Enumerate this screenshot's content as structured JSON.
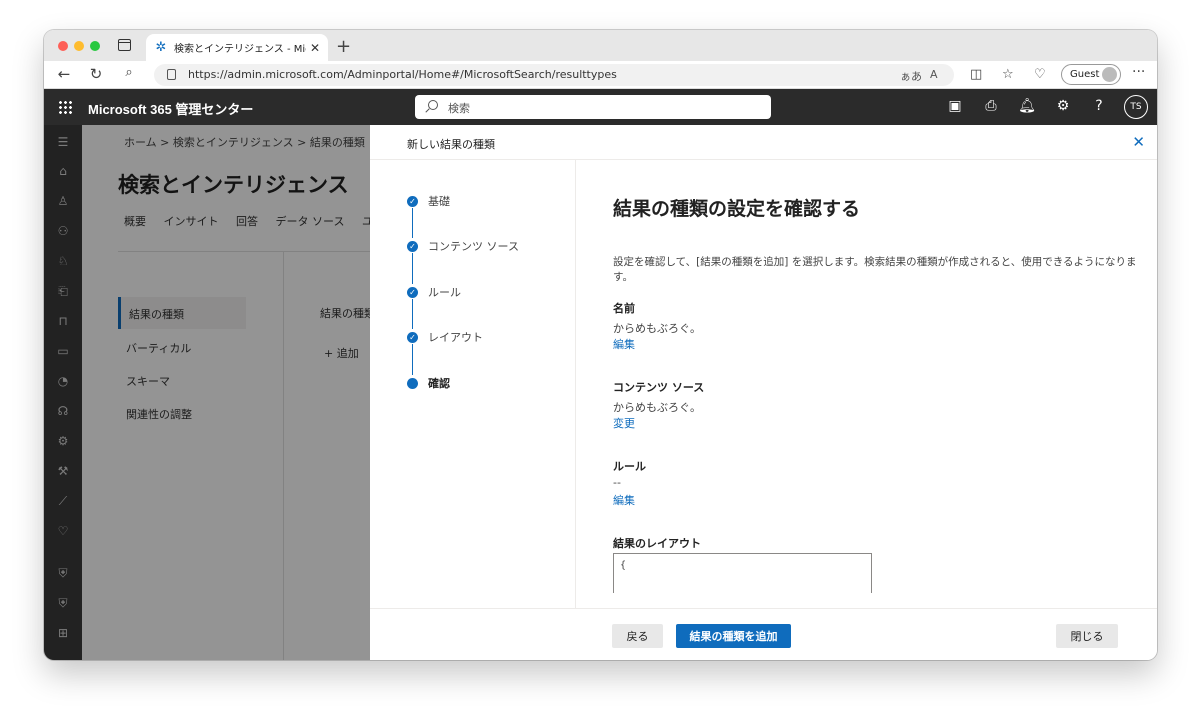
{
  "browser": {
    "tab_title": "検索とインテリジェンス - Microsoft",
    "tab_favicon": "m365-admin-icon",
    "url": "https://admin.microsoft.com/Adminportal/Home#/MicrosoftSearch/resulttypes",
    "url_reader": "ぁあ",
    "url_read_aloud": "A",
    "guest_label": "Guest",
    "more": "···"
  },
  "m365": {
    "brand": "Microsoft 365 管理センター",
    "search_placeholder": "検索",
    "avatar_initials": "TS",
    "help": "?"
  },
  "page": {
    "breadcrumb": "ホーム  >  検索とインテリジェンス  >  結果の種類",
    "title": "検索とインテリジェンス",
    "tabs": [
      "概要",
      "インサイト",
      "回答",
      "データ ソース",
      "ユ"
    ],
    "sidenav": [
      "結果の種類",
      "バーティカル",
      "スキーマ",
      "関連性の調整"
    ],
    "column_title": "結果の種類",
    "add_label": "+ 追加"
  },
  "panel": {
    "title": "新しい結果の種類",
    "close": "✕",
    "steps": [
      {
        "label": "基礎",
        "state": "done"
      },
      {
        "label": "コンテンツ ソース",
        "state": "done"
      },
      {
        "label": "ルール",
        "state": "done"
      },
      {
        "label": "レイアウト",
        "state": "done"
      },
      {
        "label": "確認",
        "state": "current"
      }
    ],
    "heading": "結果の種類の設定を確認する",
    "description": "設定を確認して、[結果の種類を追加] を選択します。検索結果の種類が作成されると、使用できるようになります。",
    "name_label": "名前",
    "name_value": "からめもぶろぐ。",
    "name_edit": "編集",
    "source_label": "コンテンツ ソース",
    "source_value": "からめもぶろぐ。",
    "source_change": "変更",
    "rules_label": "ルール",
    "rules_value": "--",
    "rules_edit": "編集",
    "layout_label": "結果のレイアウト",
    "layout_value": "{",
    "back": "戻る",
    "add": "結果の種類を追加",
    "close_button": "閉じる"
  },
  "colors": {
    "accent": "#0f6cbd",
    "header": "#2b2b2b",
    "rail": "#3b3b3b"
  }
}
